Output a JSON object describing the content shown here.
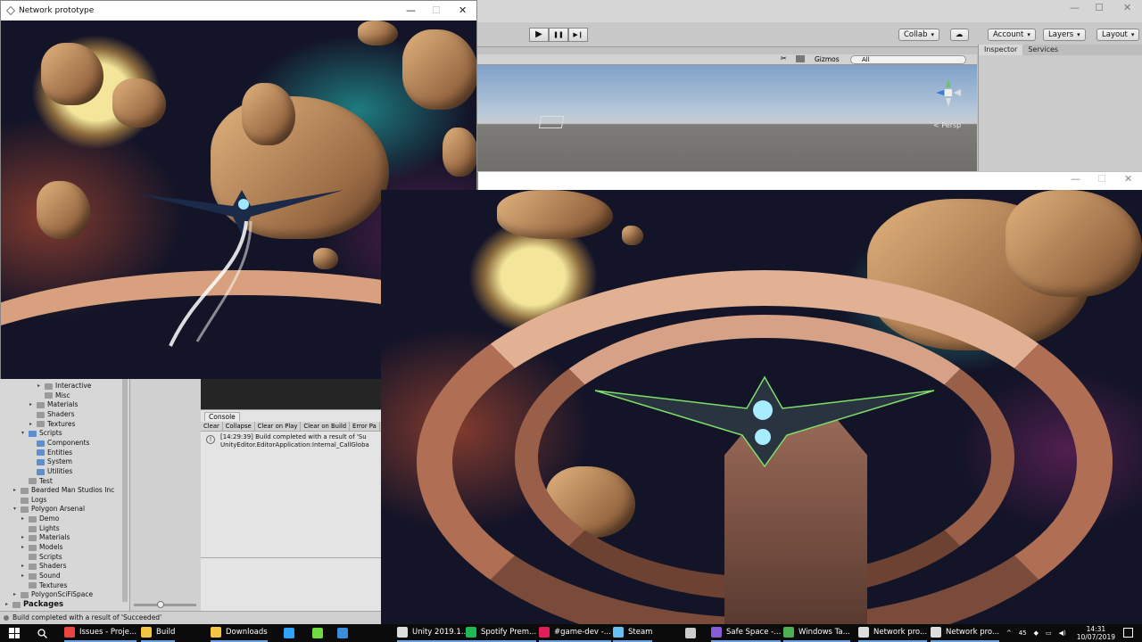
{
  "editor": {
    "toolbar": {
      "play": "▶",
      "pause": "❚❚",
      "step": "▶❙",
      "collab": "Collab",
      "cloud": "☁",
      "account": "Account",
      "layers": "Layers",
      "layout": "Layout"
    },
    "scene": {
      "gizmos": "Gizmos",
      "search_all": "All",
      "persp": "< Persp"
    },
    "inspector_tabs": [
      "Inspector",
      "Services"
    ]
  },
  "proto_window": {
    "title": "Network prototype",
    "minimize": "—",
    "maximize": "☐",
    "close": "✕"
  },
  "game_window": {
    "minimize": "—",
    "maximize": "☐",
    "close": "✕"
  },
  "project_tree": [
    {
      "label": "Interactive",
      "depth": 4,
      "arrow": "▸",
      "icon": "folder"
    },
    {
      "label": "Misc",
      "depth": 4,
      "arrow": "",
      "icon": "folder"
    },
    {
      "label": "Materials",
      "depth": 3,
      "arrow": "▸",
      "icon": "folder"
    },
    {
      "label": "Shaders",
      "depth": 3,
      "arrow": "",
      "icon": "folder"
    },
    {
      "label": "Textures",
      "depth": 3,
      "arrow": "▸",
      "icon": "folder"
    },
    {
      "label": "Scripts",
      "depth": 2,
      "arrow": "▾",
      "icon": "folder-blue"
    },
    {
      "label": "Components",
      "depth": 3,
      "arrow": "",
      "icon": "folder-blue"
    },
    {
      "label": "Entities",
      "depth": 3,
      "arrow": "",
      "icon": "folder-blue"
    },
    {
      "label": "System",
      "depth": 3,
      "arrow": "",
      "icon": "folder-blue"
    },
    {
      "label": "Utilities",
      "depth": 3,
      "arrow": "",
      "icon": "folder-blue"
    },
    {
      "label": "Test",
      "depth": 2,
      "arrow": "",
      "icon": "folder"
    },
    {
      "label": "Bearded Man Studios Inc",
      "depth": 1,
      "arrow": "▸",
      "icon": "folder"
    },
    {
      "label": "Logs",
      "depth": 1,
      "arrow": "",
      "icon": "folder"
    },
    {
      "label": "Polygon Arsenal",
      "depth": 1,
      "arrow": "▾",
      "icon": "folder"
    },
    {
      "label": "Demo",
      "depth": 2,
      "arrow": "▸",
      "icon": "folder"
    },
    {
      "label": "Lights",
      "depth": 2,
      "arrow": "",
      "icon": "folder"
    },
    {
      "label": "Materials",
      "depth": 2,
      "arrow": "▸",
      "icon": "folder"
    },
    {
      "label": "Models",
      "depth": 2,
      "arrow": "▸",
      "icon": "folder"
    },
    {
      "label": "Scripts",
      "depth": 2,
      "arrow": "",
      "icon": "folder"
    },
    {
      "label": "Shaders",
      "depth": 2,
      "arrow": "▸",
      "icon": "folder"
    },
    {
      "label": "Sound",
      "depth": 2,
      "arrow": "▸",
      "icon": "folder"
    },
    {
      "label": "Textures",
      "depth": 2,
      "arrow": "",
      "icon": "folder"
    },
    {
      "label": "PolygonSciFiSpace",
      "depth": 1,
      "arrow": "▸",
      "icon": "folder"
    },
    {
      "label": "Packages",
      "depth": 0,
      "arrow": "▸",
      "icon": "folder",
      "bold": true
    }
  ],
  "console": {
    "tab": "Console",
    "buttons": [
      "Clear",
      "Collapse",
      "Clear on Play",
      "Clear on Build",
      "Error Pa"
    ],
    "log_line1": "[14:29:39] Build completed with a result of 'Su",
    "log_line2": "UnityEditor.EditorApplication:Internal_CallGloba"
  },
  "status_bar": "Build completed with a result of 'Succeeded'",
  "taskbar": {
    "items": [
      {
        "label": "Issues - Proje...",
        "icon": "chrome-icon",
        "color": "#e8453c"
      },
      {
        "label": "Build",
        "icon": "folder-icon",
        "color": "#f4c542"
      },
      {
        "label": "Downloads",
        "icon": "folder-icon",
        "color": "#f4c542"
      },
      {
        "label": "",
        "icon": "photoshop-icon",
        "color": "#2fa3f7"
      },
      {
        "label": "",
        "icon": "upwork-icon",
        "color": "#6fda44"
      },
      {
        "label": "",
        "icon": "tool-icon",
        "color": "#3a8ddd"
      },
      {
        "label": "Unity 2019.1....",
        "icon": "unity-icon",
        "color": "#dddddd"
      },
      {
        "label": "Spotify Prem...",
        "icon": "spotify-icon",
        "color": "#1db954"
      },
      {
        "label": "#game-dev -...",
        "icon": "slack-icon",
        "color": "#e01e5a"
      },
      {
        "label": "Steam",
        "icon": "steam-icon",
        "color": "#66c0f4"
      },
      {
        "label": "",
        "icon": "unity-hub-icon",
        "color": "#cccccc"
      },
      {
        "label": "Safe Space -...",
        "icon": "visual-studio-icon",
        "color": "#8a5bd6"
      },
      {
        "label": "Windows Ta...",
        "icon": "task-manager-icon",
        "color": "#4caf50"
      },
      {
        "label": "Network pro...",
        "icon": "unity-icon",
        "color": "#dddddd"
      },
      {
        "label": "Network pro...",
        "icon": "unity-icon",
        "color": "#dddddd"
      }
    ],
    "tray_num": "45",
    "time": "14:31",
    "date": "10/07/2019"
  }
}
